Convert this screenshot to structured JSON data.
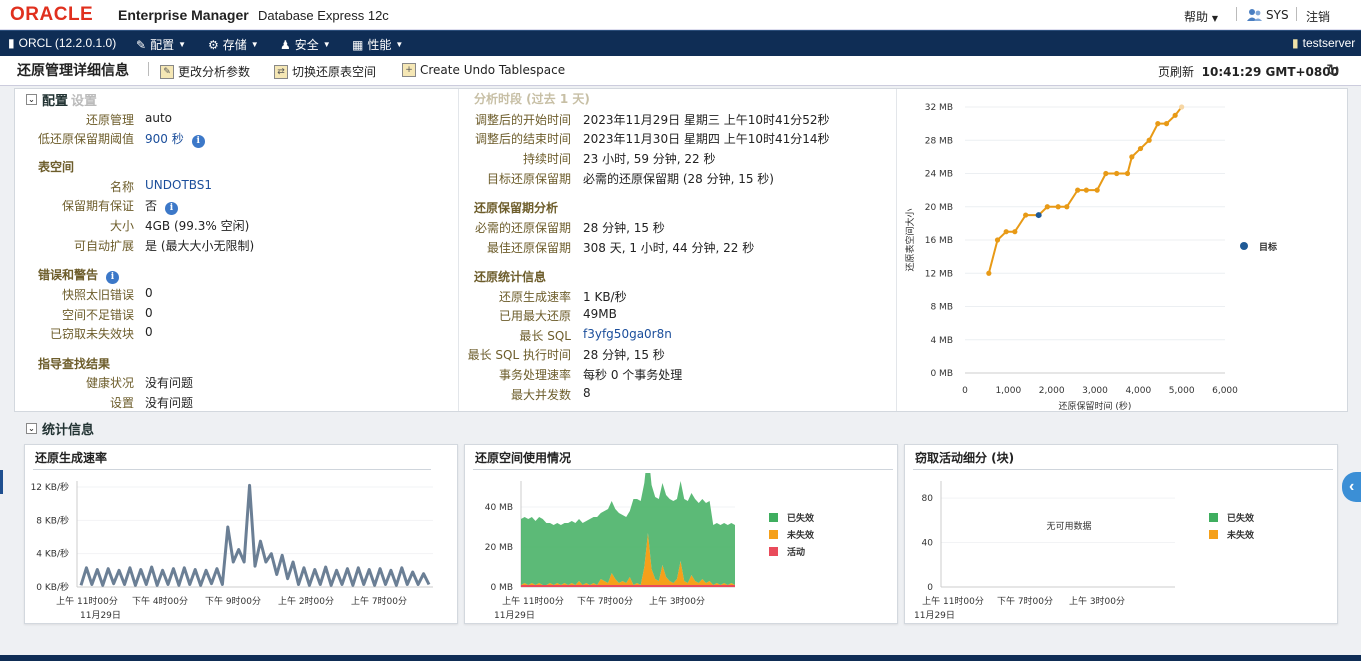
{
  "header": {
    "logo": "ORACLE",
    "product": "Enterprise Manager",
    "subtitle": "Database Express 12c",
    "help": "帮助",
    "user": "SYS",
    "logout": "注销"
  },
  "nav": {
    "db": "ORCL (12.2.0.1.0)",
    "items": [
      "配置",
      "存储",
      "安全",
      "性能"
    ],
    "server": "testserver"
  },
  "page": {
    "title": "还原管理详细信息",
    "actions": [
      "更改分析参数",
      "切换还原表空间",
      "Create Undo Tablespace"
    ],
    "refresh_label": "页刷新",
    "refresh_time": "10:41:29 GMT+0800"
  },
  "config": {
    "header": "配置",
    "shadow_label": "设置",
    "rows1": [
      {
        "k": "还原管理",
        "v": "auto"
      },
      {
        "k": "低还原保留期阈值",
        "v": "900 秒"
      }
    ],
    "tablespace": {
      "title": "表空间",
      "rows": [
        {
          "k": "名称",
          "v": "UNDOTBS1"
        },
        {
          "k": "保留期有保证",
          "v": "否"
        },
        {
          "k": "大小",
          "v": "4GB (99.3% 空闲)"
        },
        {
          "k": "可自动扩展",
          "v": "是 (最大大小无限制)"
        }
      ]
    },
    "errors": {
      "title": "错误和警告",
      "rows": [
        {
          "k": "快照太旧错误",
          "v": "0"
        },
        {
          "k": "空间不足错误",
          "v": "0"
        },
        {
          "k": "已窃取未失效块",
          "v": "0"
        }
      ]
    },
    "advisor": {
      "title": "指导查找结果",
      "rows": [
        {
          "k": "健康状况",
          "v": "没有问题"
        },
        {
          "k": "设置",
          "v": "没有问题"
        }
      ]
    },
    "period": {
      "title": "分析时段 (过去 1 天)",
      "rows": [
        {
          "k": "调整后的开始时间",
          "v": "2023年11月29日 星期三 上午10时41分52秒"
        },
        {
          "k": "调整后的结束时间",
          "v": "2023年11月30日 星期四 上午10时41分14秒"
        },
        {
          "k": "持续时间",
          "v": "23 小时, 59 分钟, 22 秒"
        },
        {
          "k": "目标还原保留期",
          "v": "必需的还原保留期 (28 分钟, 15 秒)"
        }
      ]
    },
    "retention": {
      "title": "还原保留期分析",
      "rows": [
        {
          "k": "必需的还原保留期",
          "v": "28 分钟, 15 秒"
        },
        {
          "k": "最佳还原保留期",
          "v": "308 天, 1 小时, 44 分钟, 22 秒"
        }
      ]
    },
    "undostats": {
      "title": "还原统计信息",
      "rows": [
        {
          "k": "还原生成速率",
          "v": "1 KB/秒"
        },
        {
          "k": "已用最大还原",
          "v": "49MB"
        },
        {
          "k": "最长 SQL",
          "v": "f3yfg50ga0r8n"
        },
        {
          "k": "最长 SQL 执行时间",
          "v": "28 分钟, 15 秒"
        },
        {
          "k": "事务处理速率",
          "v": "每秒 0 个事务处理"
        },
        {
          "k": "最大并发数",
          "v": "8"
        }
      ]
    }
  },
  "stats": {
    "header": "统计信息",
    "panels": [
      "还原生成速率",
      "还原空间使用情况",
      "窃取活动细分 (块)"
    ]
  },
  "chart_data": [
    {
      "type": "line",
      "title": "",
      "xlabel": "还原保留时间 (秒)",
      "ylabel": "还原表空间大小",
      "x_ticks": [
        "0",
        "1,000",
        "2,000",
        "3,000",
        "4,000",
        "5,000",
        "6,000"
      ],
      "y_ticks": [
        "0 MB",
        "4 MB",
        "8 MB",
        "12 MB",
        "16 MB",
        "20 MB",
        "24 MB",
        "28 MB",
        "32 MB"
      ],
      "xlim": [
        0,
        6000
      ],
      "ylim": [
        0,
        32
      ],
      "series": [
        {
          "name": "",
          "color": "#e89a16",
          "x": [
            550,
            750,
            950,
            1150,
            1400,
            1700,
            1900,
            2150,
            2350,
            2600,
            2800,
            3050,
            3250,
            3500,
            3750,
            3850,
            4050,
            4250,
            4450,
            4650,
            4850,
            5000
          ],
          "y": [
            12,
            16,
            17,
            17,
            19,
            19,
            20,
            20,
            20,
            22,
            22,
            22,
            24,
            24,
            24,
            26,
            27,
            28,
            30,
            30,
            31,
            32
          ]
        }
      ],
      "target": {
        "name": "目标",
        "x": 1700,
        "y": 19,
        "color": "#1f5a96"
      }
    },
    {
      "type": "line",
      "title": "还原生成速率",
      "y_ticks": [
        "0 KB/秒",
        "4 KB/秒",
        "8 KB/秒",
        "12 KB/秒"
      ],
      "ylim": [
        0,
        12
      ],
      "x_ticks": [
        "上午 11时00分",
        "下午 4时00分",
        "下午 9时00分",
        "上午 2时00分",
        "上午 7时00分"
      ],
      "x_sub": "11月29日",
      "color": "#6b7f95",
      "values": [
        0.2,
        2.3,
        0.3,
        2.1,
        0.2,
        2.2,
        0.4,
        2,
        0.3,
        2.3,
        0.2,
        2.1,
        0.3,
        2.4,
        0.2,
        2,
        0.3,
        2.2,
        0.2,
        2.3,
        0.3,
        2.1,
        0.2,
        2,
        0.4,
        2.2,
        0.3,
        7.2,
        3,
        4.5,
        3,
        12.2,
        2.5,
        5.5,
        3,
        4,
        1.5,
        3.8,
        1,
        3,
        0.3,
        2.3,
        0.2,
        2.1,
        0.3,
        2.4,
        0.2,
        2,
        0.3,
        2.2,
        0.2,
        2.3,
        0.3,
        2.1,
        0.2,
        2.2,
        0.3,
        2,
        0.2,
        2.3,
        0.3,
        1.8,
        0.3,
        1.6,
        0.3
      ]
    },
    {
      "type": "area",
      "title": "还原空间使用情况",
      "y_ticks": [
        "0 MB",
        "20 MB",
        "40 MB"
      ],
      "ylim": [
        0,
        50
      ],
      "x_ticks": [
        "上午 11时00分",
        "下午 7时00分",
        "上午 3时00分"
      ],
      "x_sub": "11月29日",
      "series": [
        {
          "name": "已失效",
          "color": "#3fae5f",
          "values": [
            33,
            33,
            33,
            33,
            32,
            33,
            33,
            31,
            30,
            30,
            30,
            30,
            30,
            31,
            31,
            31,
            31,
            31,
            31,
            33,
            33,
            34,
            33,
            35,
            37,
            36,
            35,
            35,
            33,
            33,
            33,
            43,
            42,
            42,
            42,
            42,
            42,
            41,
            41,
            41,
            41,
            41,
            41,
            40,
            40,
            41,
            41,
            41,
            41,
            40,
            40,
            40,
            40,
            30,
            30,
            30,
            30,
            30,
            30,
            30
          ]
        },
        {
          "name": "未失效",
          "color": "#f5a01a",
          "values": [
            0,
            1,
            0,
            1,
            0,
            1,
            0,
            0,
            1,
            0,
            1,
            0,
            1,
            0,
            1,
            0,
            2,
            0,
            1,
            0,
            1,
            0,
            3,
            2,
            1,
            6,
            3,
            1,
            2,
            1,
            4,
            0,
            1,
            0,
            9,
            26,
            8,
            3,
            2,
            10,
            4,
            2,
            1,
            3,
            12,
            2,
            1,
            5,
            2,
            1,
            3,
            1,
            2,
            0,
            1,
            0,
            1,
            0,
            1,
            0
          ]
        },
        {
          "name": "活动",
          "color": "#e94b5b",
          "values": [
            1,
            1,
            1,
            1,
            1,
            1,
            1,
            1,
            1,
            1,
            1,
            1,
            1,
            1,
            1,
            1,
            1,
            1,
            1,
            1,
            1,
            1,
            1,
            1,
            1,
            1,
            1,
            1,
            1,
            1,
            1,
            1,
            1,
            1,
            1,
            1,
            1,
            1,
            1,
            1,
            1,
            1,
            1,
            1,
            1,
            1,
            1,
            1,
            1,
            1,
            1,
            1,
            1,
            1,
            1,
            1,
            1,
            1,
            1,
            1
          ]
        }
      ]
    },
    {
      "type": "area",
      "title": "窃取活动细分 (块)",
      "y_ticks": [
        "0",
        "40",
        "80"
      ],
      "ylim": [
        0,
        90
      ],
      "x_ticks": [
        "上午 11时00分",
        "下午 7时00分",
        "上午 3时00分"
      ],
      "x_sub": "11月29日",
      "empty_text": "无可用数据",
      "series": [
        {
          "name": "已失效",
          "color": "#3fae5f",
          "values": []
        },
        {
          "name": "未失效",
          "color": "#f5a01a",
          "values": []
        }
      ]
    }
  ]
}
